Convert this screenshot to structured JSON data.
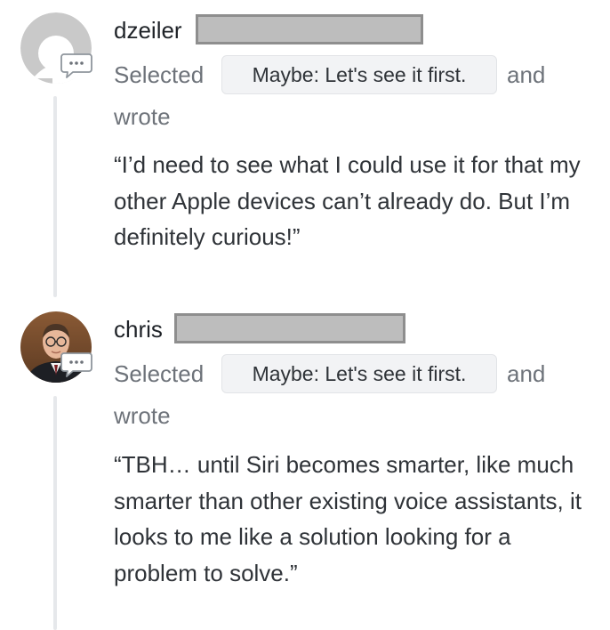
{
  "comments": [
    {
      "username": "dzeiler",
      "selected_label": "Selected",
      "choice": "Maybe: Let's see it first.",
      "and_label": "and",
      "wrote_label": "wrote",
      "quote": "“I’d need to see what I could use it for that my other Apple devices can’t already do. But I’m definitely curious!”",
      "avatar": "default-avatar-icon"
    },
    {
      "username": "chris",
      "selected_label": "Selected",
      "choice": "Maybe: Let's see it first.",
      "and_label": "and",
      "wrote_label": "wrote",
      "quote": "“TBH… until Siri becomes smarter, like much smarter than other existing voice assistants, it looks to me like a solution looking for a problem to solve.”",
      "avatar": "user-photo-avatar"
    }
  ],
  "icons": {
    "comment": "speech-bubble-icon"
  },
  "colors": {
    "text": "#2f3338",
    "muted": "#6e737a",
    "pill_bg": "#f2f3f5",
    "thread_line": "#e6e8eb",
    "redaction": "#bdbdbd"
  }
}
